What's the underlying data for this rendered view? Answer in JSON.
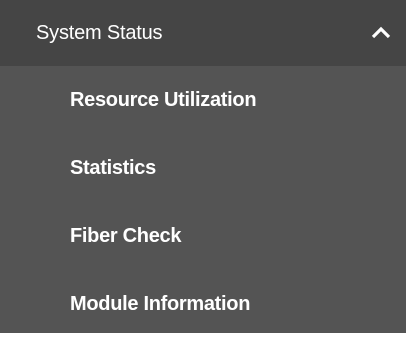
{
  "menu": {
    "header": {
      "label": "System Status",
      "icon": "chevron-up-icon",
      "expanded": true
    },
    "items": [
      {
        "label": "Resource Utilization"
      },
      {
        "label": "Statistics"
      },
      {
        "label": "Fiber Check"
      },
      {
        "label": "Module Information"
      }
    ]
  },
  "colors": {
    "header_background": "#454545",
    "menu_background": "#545454",
    "text": "#ffffff"
  }
}
